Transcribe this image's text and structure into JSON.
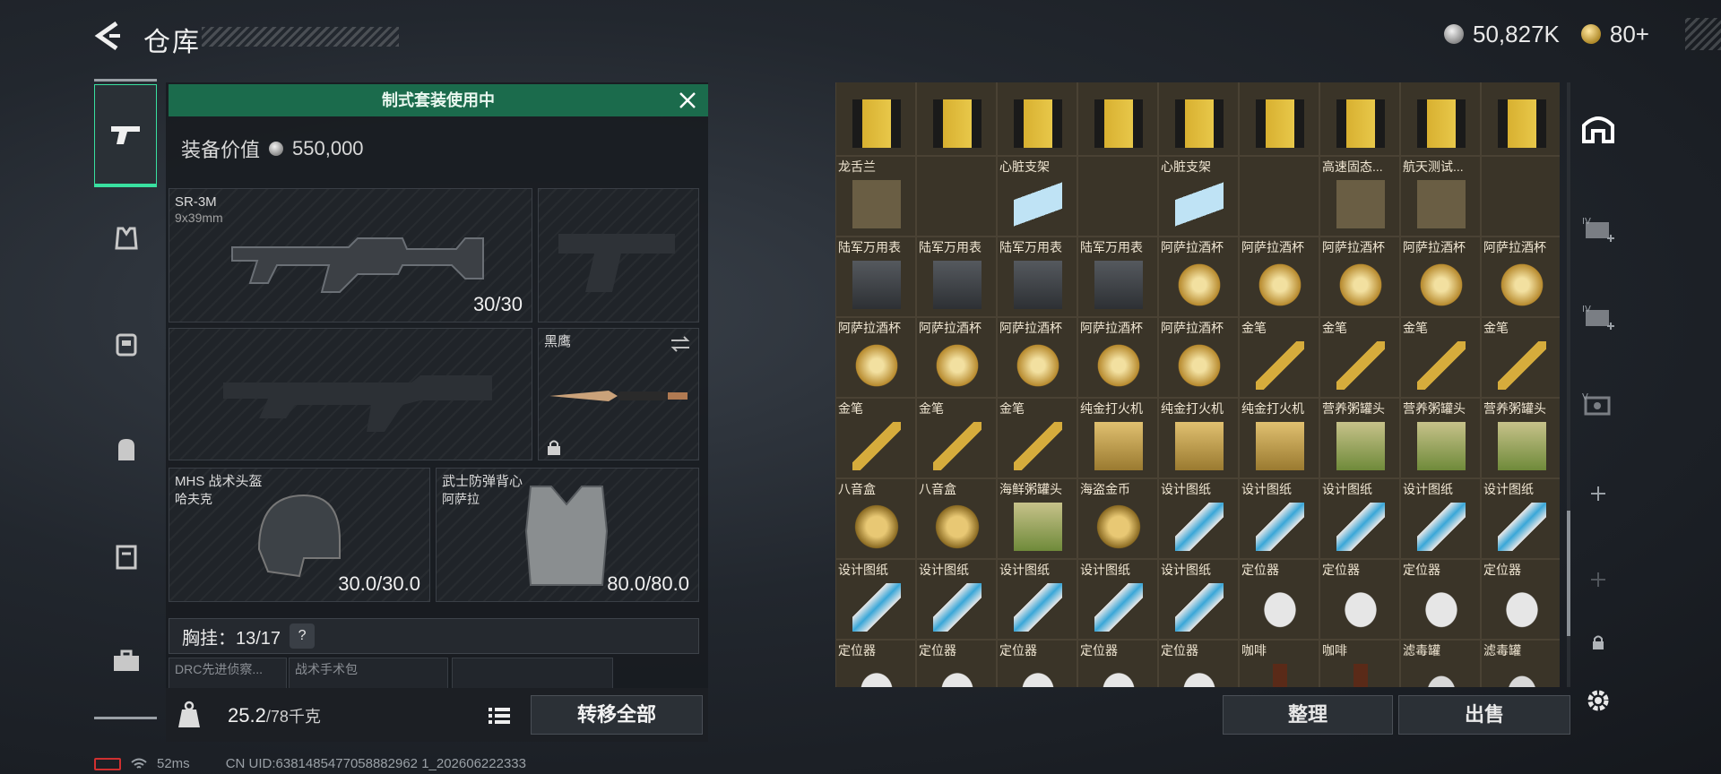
{
  "header": {
    "title": "仓库",
    "currency_1": "50,827K",
    "currency_2": "80+"
  },
  "nav": {
    "items": [
      "weapon",
      "armor",
      "backpack-chest",
      "backpack",
      "case",
      "toolbox"
    ]
  },
  "loadout": {
    "suit_banner": "制式套装使用中",
    "equip_value_label": "装备价值",
    "equip_value": "550,000",
    "primary": {
      "name": "SR-3M",
      "caliber": "9x39mm",
      "ammo": "30/30"
    },
    "melee": {
      "name": "黑鹰"
    },
    "helmet": {
      "name": "MHS 战术头盔",
      "sub": "哈夫克",
      "durability": "30.0/30.0"
    },
    "armor": {
      "name": "武士防弹背心",
      "sub": "阿萨拉",
      "durability": "80.0/80.0"
    },
    "chest_rig": "胸挂：13/17",
    "help": "?",
    "rig_items": [
      "DRC先进侦察...",
      "战术手术包",
      ""
    ],
    "weight_value": "25.2",
    "weight_max": "/78千克",
    "transfer_all": "转移全部"
  },
  "storage": {
    "rows": [
      [
        "",
        "",
        "",
        "",
        "",
        "",
        "",
        "",
        ""
      ],
      [
        "龙舌兰",
        "",
        "心脏支架",
        "",
        "心脏支架",
        "",
        "高速固态...",
        "航天测试...",
        ""
      ],
      [
        "陆军万用表",
        "陆军万用表",
        "陆军万用表",
        "陆军万用表",
        "阿萨拉酒杯",
        "阿萨拉酒杯",
        "阿萨拉酒杯",
        "阿萨拉酒杯",
        "阿萨拉酒杯"
      ],
      [
        "阿萨拉酒杯",
        "阿萨拉酒杯",
        "阿萨拉酒杯",
        "阿萨拉酒杯",
        "阿萨拉酒杯",
        "金笔",
        "金笔",
        "金笔",
        "金笔"
      ],
      [
        "金笔",
        "金笔",
        "金笔",
        "纯金打火机",
        "纯金打火机",
        "纯金打火机",
        "营养粥罐头",
        "营养粥罐头",
        "营养粥罐头"
      ],
      [
        "八音盒",
        "八音盒",
        "海鲜粥罐头",
        "海盗金币",
        "设计图纸",
        "设计图纸",
        "设计图纸",
        "设计图纸",
        "设计图纸"
      ],
      [
        "设计图纸",
        "设计图纸",
        "设计图纸",
        "设计图纸",
        "设计图纸",
        "定位器",
        "定位器",
        "定位器",
        "定位器"
      ],
      [
        "定位器",
        "定位器",
        "定位器",
        "定位器",
        "定位器",
        "咖啡",
        "咖啡",
        "滤毒罐",
        "滤毒罐"
      ]
    ],
    "sort": "整理",
    "sell": "出售"
  },
  "status": {
    "ping": "52ms",
    "uid": "CN UID:6381485477058882962 1_202606222333"
  },
  "colors": {
    "accent_green": "#39e0a0",
    "banner_green": "#1b6b4c",
    "cell_bg": "#3a3428"
  }
}
